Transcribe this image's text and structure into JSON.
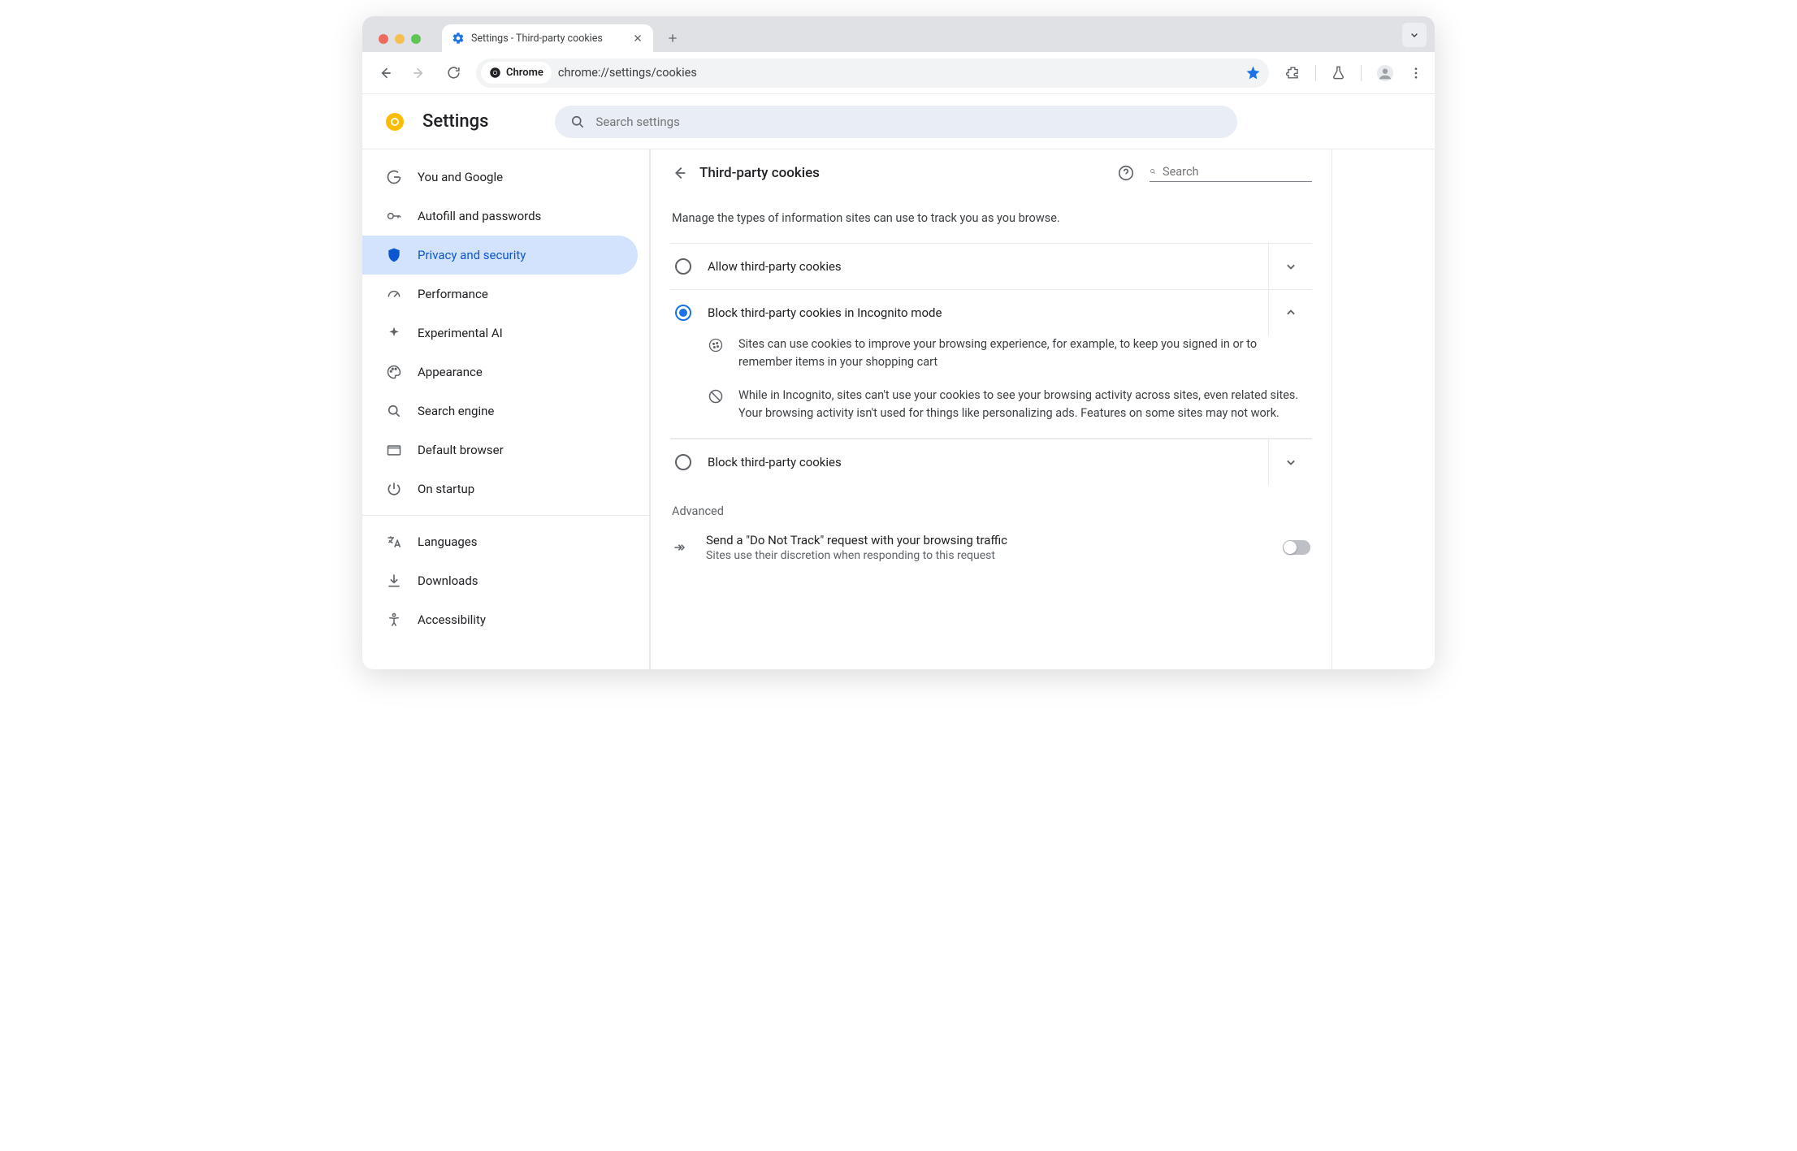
{
  "tab": {
    "title": "Settings - Third-party cookies"
  },
  "omnibox": {
    "chip": "Chrome",
    "url": "chrome://settings/cookies"
  },
  "header": {
    "title": "Settings",
    "search_placeholder": "Search settings"
  },
  "sidebar": {
    "items": [
      {
        "label": "You and Google"
      },
      {
        "label": "Autofill and passwords"
      },
      {
        "label": "Privacy and security"
      },
      {
        "label": "Performance"
      },
      {
        "label": "Experimental AI"
      },
      {
        "label": "Appearance"
      },
      {
        "label": "Search engine"
      },
      {
        "label": "Default browser"
      },
      {
        "label": "On startup"
      }
    ],
    "items2": [
      {
        "label": "Languages"
      },
      {
        "label": "Downloads"
      },
      {
        "label": "Accessibility"
      }
    ]
  },
  "card": {
    "title": "Third-party cookies",
    "search_placeholder": "Search",
    "intro": "Manage the types of information sites can use to track you as you browse.",
    "options": [
      {
        "label": "Allow third-party cookies"
      },
      {
        "label": "Block third-party cookies in Incognito mode"
      },
      {
        "label": "Block third-party cookies"
      }
    ],
    "detail1": "Sites can use cookies to improve your browsing experience, for example, to keep you signed in or to remember items in your shopping cart",
    "detail2": "While in Incognito, sites can't use your cookies to see your browsing activity across sites, even related sites. Your browsing activity isn't used for things like personalizing ads. Features on some sites may not work.",
    "advanced_heading": "Advanced",
    "dnt_title": "Send a \"Do Not Track\" request with your browsing traffic",
    "dnt_sub": "Sites use their discretion when responding to this request"
  }
}
